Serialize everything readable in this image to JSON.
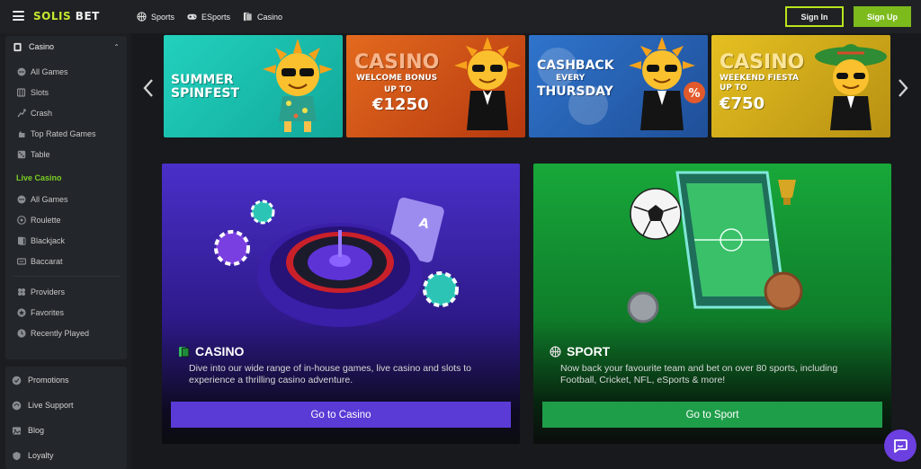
{
  "header": {
    "logo_part1": "SOLIS",
    "logo_part2": "BET",
    "nav": [
      {
        "label": "Sports",
        "icon": "basketball-icon"
      },
      {
        "label": "ESports",
        "icon": "gamepad-icon"
      },
      {
        "label": "Casino",
        "icon": "cards-icon"
      }
    ],
    "signin_label": "Sign In",
    "signup_label": "Sign Up",
    "accent": "#b9e51d",
    "signup_color": "#7dbb1d"
  },
  "sidebar": {
    "casino_header": "Casino",
    "casino_items": [
      {
        "label": "All Games",
        "icon": "all-games-icon"
      },
      {
        "label": "Slots",
        "icon": "slots-icon"
      },
      {
        "label": "Crash",
        "icon": "crash-icon"
      },
      {
        "label": "Top Rated Games",
        "icon": "hand-icon"
      },
      {
        "label": "Table",
        "icon": "dice-icon"
      }
    ],
    "live_header": "Live Casino",
    "live_items": [
      {
        "label": "All Games",
        "icon": "all-games-icon"
      },
      {
        "label": "Roulette",
        "icon": "roulette-icon"
      },
      {
        "label": "Blackjack",
        "icon": "blackjack-icon"
      },
      {
        "label": "Baccarat",
        "icon": "baccarat-icon"
      }
    ],
    "extra_items": [
      {
        "label": "Providers",
        "icon": "providers-icon"
      },
      {
        "label": "Favorites",
        "icon": "star-icon"
      },
      {
        "label": "Recently Played",
        "icon": "clock-icon"
      }
    ],
    "bottom_items": [
      {
        "label": "Promotions",
        "icon": "promo-icon"
      },
      {
        "label": "Live Support",
        "icon": "support-icon"
      },
      {
        "label": "Blog",
        "icon": "blog-icon"
      },
      {
        "label": "Loyalty",
        "icon": "loyalty-icon"
      }
    ],
    "live_color": "#7ccf27"
  },
  "banners": [
    {
      "line1": "SUMMER",
      "line2": "SPINFEST",
      "bg": "#1fc6b2"
    },
    {
      "line1": "CASINO",
      "line2": "WELCOME BONUS",
      "line3": "UP TO",
      "line4": "€1250",
      "bg": "#d4571c"
    },
    {
      "line1": "CASHBACK",
      "line2": "EVERY",
      "line3": "THURSDAY",
      "bg": "#2a66b8"
    },
    {
      "line1": "CASINO",
      "line2": "WEEKEND FIESTA",
      "line3": "UP TO",
      "line4": "€750",
      "bg": "#d8b21a"
    }
  ],
  "cards": {
    "casino": {
      "title": "CASINO",
      "desc": "Dive into our wide range of in-house games, live casino and slots to experience a thrilling casino adventure.",
      "cta": "Go to Casino",
      "btn_color": "#5a3bd6"
    },
    "sport": {
      "title": "SPORT",
      "desc": "Now back your favourite team and bet on over 80 sports, including Football, Cricket, NFL, eSports & more!",
      "cta": "Go to Sport",
      "btn_color": "#1f9e4a"
    }
  }
}
